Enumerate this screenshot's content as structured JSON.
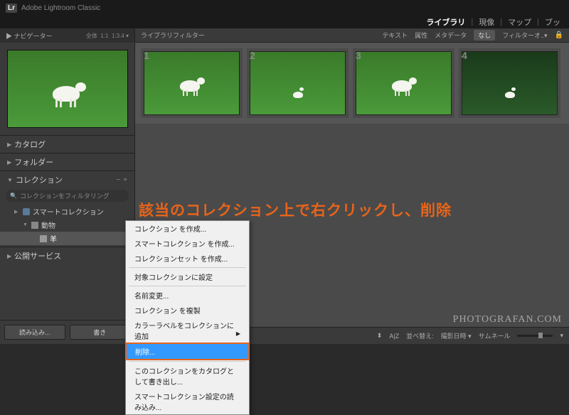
{
  "app": {
    "logo": "Lr",
    "title": "Adobe Lightroom Classic"
  },
  "topnav": {
    "library": "ライブラリ",
    "develop": "現像",
    "map": "マップ",
    "book": "ブッ"
  },
  "navigator": {
    "label": "ナビゲーター",
    "fit": "全体",
    "ratio1": "1:1",
    "ratio2": "1:3.4",
    "tri": "▾"
  },
  "panels": {
    "catalog": "カタログ",
    "folder": "フォルダー",
    "collection": "コレクション",
    "publish": "公開サービス",
    "plus": "+",
    "minus": "−"
  },
  "collection": {
    "filter_placeholder": "コレクションをフィルタリング",
    "items": [
      {
        "label": "スマートコレクション",
        "icon": "smart"
      },
      {
        "label": "動物",
        "icon": "folder"
      },
      {
        "label": "羊",
        "icon": "coll"
      }
    ]
  },
  "footer": {
    "import": "読み込み...",
    "export": "書き"
  },
  "filterbar": {
    "label": "ライブラリフィルター",
    "text": "テキスト",
    "attr": "属性",
    "meta": "メタデータ",
    "none": "なし",
    "filteroff": "フィルターオ..▾"
  },
  "thumbs": [
    "1",
    "2",
    "3",
    "4"
  ],
  "annotation": "該当のコレクション上で右クリックし、削除",
  "ctxmenu": {
    "items": [
      "コレクション を作成...",
      "スマートコレクション を作成...",
      "コレクションセット を作成...",
      "__sep",
      "対象コレクションに設定",
      "__sep",
      "名前変更...",
      "コレクション を複製",
      "カラーラベルをコレクションに追加",
      "__hl:削除...",
      "__sep",
      "このコレクションをカタログとして書き出し...",
      "スマートコレクション設定の読み込み..."
    ]
  },
  "toolbar": {
    "sort_icon": "⬍",
    "az": "A|Z",
    "sort_label": "並べ替え:",
    "sort_val": "撮影日時 ▾",
    "thumb_label": "サムネール"
  },
  "watermark": "PHOTOGRAFAN.COM"
}
